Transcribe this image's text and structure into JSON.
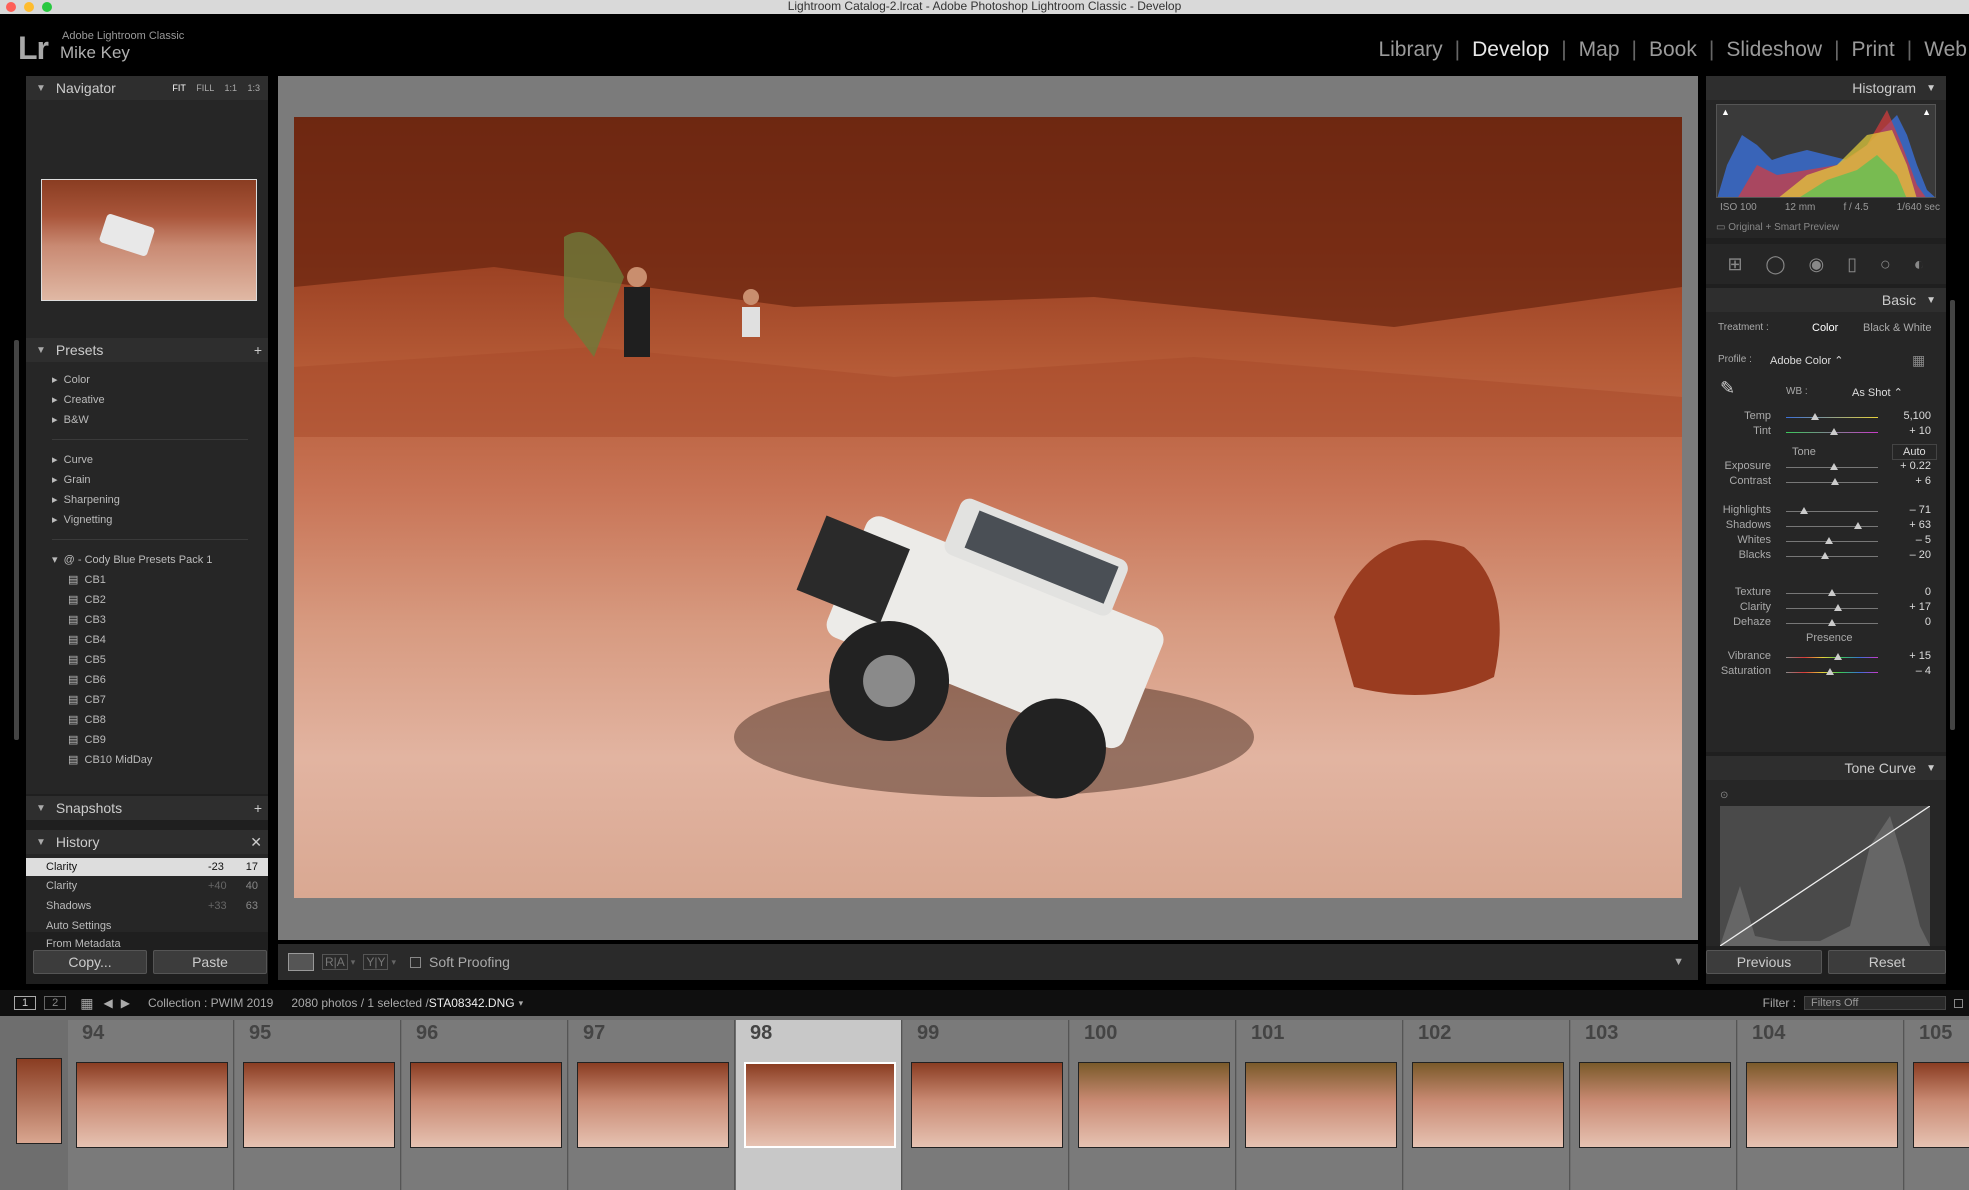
{
  "window": {
    "title": "Lightroom Catalog-2.lrcat - Adobe Photoshop Lightroom Classic - Develop"
  },
  "identity": {
    "logo": "Lr",
    "app_name": "Adobe Lightroom Classic",
    "user": "Mike Key"
  },
  "modules": [
    "Library",
    "Develop",
    "Map",
    "Book",
    "Slideshow",
    "Print",
    "Web"
  ],
  "active_module": "Develop",
  "navigator": {
    "title": "Navigator",
    "zoom_options": [
      "FIT",
      "FILL",
      "1:1",
      "1:3"
    ]
  },
  "presets": {
    "title": "Presets",
    "groups1": [
      "Color",
      "Creative",
      "B&W"
    ],
    "groups2": [
      "Curve",
      "Grain",
      "Sharpening",
      "Vignetting"
    ],
    "pack": "@ - Cody Blue Presets Pack 1",
    "items": [
      "CB1",
      "CB2",
      "CB3",
      "CB4",
      "CB5",
      "CB6",
      "CB7",
      "CB8",
      "CB9",
      "CB10 MidDay"
    ]
  },
  "snapshots": {
    "title": "Snapshots"
  },
  "history": {
    "title": "History",
    "rows": [
      {
        "name": "Clarity",
        "from": "-23",
        "to": "17"
      },
      {
        "name": "Clarity",
        "from": "+40",
        "to": "40"
      },
      {
        "name": "Shadows",
        "from": "+33",
        "to": "63"
      },
      {
        "name": "Auto Settings",
        "from": "",
        "to": ""
      },
      {
        "name": "From Metadata",
        "from": "",
        "to": ""
      }
    ]
  },
  "left_buttons": {
    "copy": "Copy...",
    "paste": "Paste"
  },
  "toolbar": {
    "soft_proofing": "Soft Proofing"
  },
  "histogram": {
    "title": "Histogram",
    "iso": "ISO 100",
    "focal": "12 mm",
    "aperture": "f / 4.5",
    "shutter": "1/640 sec",
    "preview": "Original + Smart Preview"
  },
  "basic": {
    "title": "Basic",
    "treatment_label": "Treatment :",
    "color": "Color",
    "bw": "Black & White",
    "profile_label": "Profile :",
    "profile": "Adobe Color",
    "wb_label": "WB :",
    "wb": "As Shot",
    "tone_label": "Tone",
    "auto": "Auto",
    "presence_label": "Presence",
    "sliders": [
      {
        "label": "Temp",
        "value": "5,100",
        "pos": 0.32
      },
      {
        "label": "Tint",
        "value": "+ 10",
        "pos": 0.52
      },
      {
        "label": "Exposure",
        "value": "+ 0.22",
        "pos": 0.52
      },
      {
        "label": "Contrast",
        "value": "+ 6",
        "pos": 0.53
      },
      {
        "label": "Highlights",
        "value": "– 71",
        "pos": 0.2
      },
      {
        "label": "Shadows",
        "value": "+ 63",
        "pos": 0.78
      },
      {
        "label": "Whites",
        "value": "– 5",
        "pos": 0.47
      },
      {
        "label": "Blacks",
        "value": "– 20",
        "pos": 0.42
      },
      {
        "label": "Texture",
        "value": "0",
        "pos": 0.5
      },
      {
        "label": "Clarity",
        "value": "+ 17",
        "pos": 0.57
      },
      {
        "label": "Dehaze",
        "value": "0",
        "pos": 0.5
      },
      {
        "label": "Vibrance",
        "value": "+ 15",
        "pos": 0.56
      },
      {
        "label": "Saturation",
        "value": "– 4",
        "pos": 0.48
      }
    ]
  },
  "tone_curve": {
    "title": "Tone Curve"
  },
  "right_buttons": {
    "previous": "Previous",
    "reset": "Reset"
  },
  "filmstrip_bar": {
    "collection": "Collection : PWIM 2019",
    "count": "2080 photos / 1 selected /",
    "filename": "STA08342.DNG",
    "filter_label": "Filter :",
    "filter_value": "Filters Off"
  },
  "filmstrip": [
    "94",
    "95",
    "96",
    "97",
    "98",
    "99",
    "100",
    "101",
    "102",
    "103",
    "104",
    "105"
  ]
}
